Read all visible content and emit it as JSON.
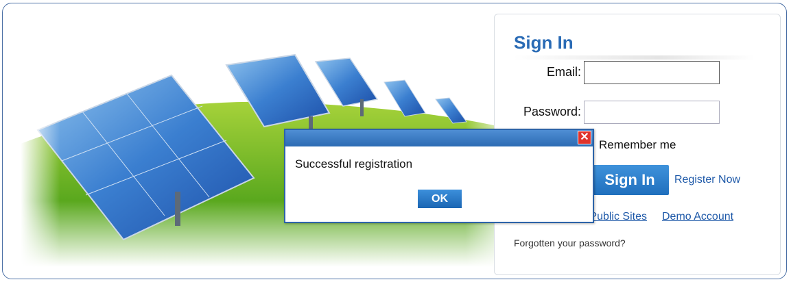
{
  "signin": {
    "title": "Sign In",
    "email_label": "Email:",
    "email_value": "",
    "password_label": "Password:",
    "password_value": "",
    "remember_label": "Remember me",
    "signin_button": "Sign In",
    "register_link": "Register Now",
    "public_sites_link": "Public Sites",
    "demo_link": "Demo Account",
    "forgot_link": "Forgotten your password?"
  },
  "dialog": {
    "message": "Successful registration",
    "ok_button": "OK",
    "close_icon": "close-icon"
  },
  "colors": {
    "accent_blue": "#2a6bb5",
    "button_blue": "#1f6fbd",
    "close_red": "#e0332b"
  }
}
